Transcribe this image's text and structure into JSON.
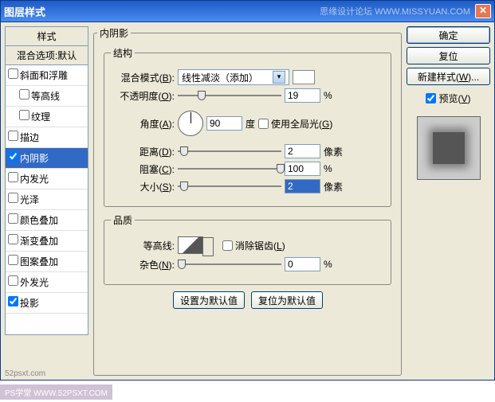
{
  "titlebar": {
    "title": "图层样式",
    "siteText": "思缘设计论坛  WWW.MISSYUAN.COM"
  },
  "leftPanel": {
    "header": "样式",
    "blendHeader": "混合选项:默认",
    "items": [
      {
        "label": "斜面和浮雕",
        "checked": false,
        "indent": false
      },
      {
        "label": "等高线",
        "checked": false,
        "indent": true
      },
      {
        "label": "纹理",
        "checked": false,
        "indent": true
      },
      {
        "label": "描边",
        "checked": false,
        "indent": false
      },
      {
        "label": "内阴影",
        "checked": true,
        "indent": false,
        "selected": true
      },
      {
        "label": "内发光",
        "checked": false,
        "indent": false
      },
      {
        "label": "光泽",
        "checked": false,
        "indent": false
      },
      {
        "label": "颜色叠加",
        "checked": false,
        "indent": false
      },
      {
        "label": "渐变叠加",
        "checked": false,
        "indent": false
      },
      {
        "label": "图案叠加",
        "checked": false,
        "indent": false
      },
      {
        "label": "外发光",
        "checked": false,
        "indent": false
      },
      {
        "label": "投影",
        "checked": true,
        "indent": false
      }
    ]
  },
  "main": {
    "title": "内阴影",
    "structure": {
      "legend": "结构",
      "blendMode": {
        "label": "混合模式(B):",
        "hotkey": "B",
        "value": "线性减淡（添加）"
      },
      "opacity": {
        "label": "不透明度(O):",
        "hotkey": "O",
        "value": "19",
        "unit": "%",
        "pos": 19
      },
      "angle": {
        "label": "角度(A):",
        "hotkey": "A",
        "value": "90",
        "unit": "度",
        "globalLight": "使用全局光(G)",
        "globalHotkey": "G",
        "globalChecked": false
      },
      "distance": {
        "label": "距离(D):",
        "hotkey": "D",
        "value": "2",
        "unit": "像素",
        "pos": 2
      },
      "choke": {
        "label": "阻塞(C):",
        "hotkey": "C",
        "value": "100",
        "unit": "%",
        "pos": 100
      },
      "size": {
        "label": "大小(S):",
        "hotkey": "S",
        "value": "2",
        "unit": "像素",
        "pos": 2,
        "selected": true
      }
    },
    "quality": {
      "legend": "品质",
      "contour": {
        "label": "等高线:",
        "antiAlias": "消除锯齿(L)",
        "antiHotkey": "L",
        "antiChecked": false
      },
      "noise": {
        "label": "杂色(N):",
        "hotkey": "N",
        "value": "0",
        "unit": "%",
        "pos": 0
      }
    },
    "resetBtns": {
      "makeDefault": "设置为默认值",
      "resetDefault": "复位为默认值"
    }
  },
  "right": {
    "ok": "确定",
    "cancel": "复位",
    "newStyle": "新建样式(W)...",
    "newStyleHotkey": "W",
    "preview": "预览(V)",
    "previewHotkey": "V",
    "previewChecked": true
  },
  "watermark1": "PS学堂  WWW.52PSXT.COM",
  "watermark2": "52psxt.com"
}
